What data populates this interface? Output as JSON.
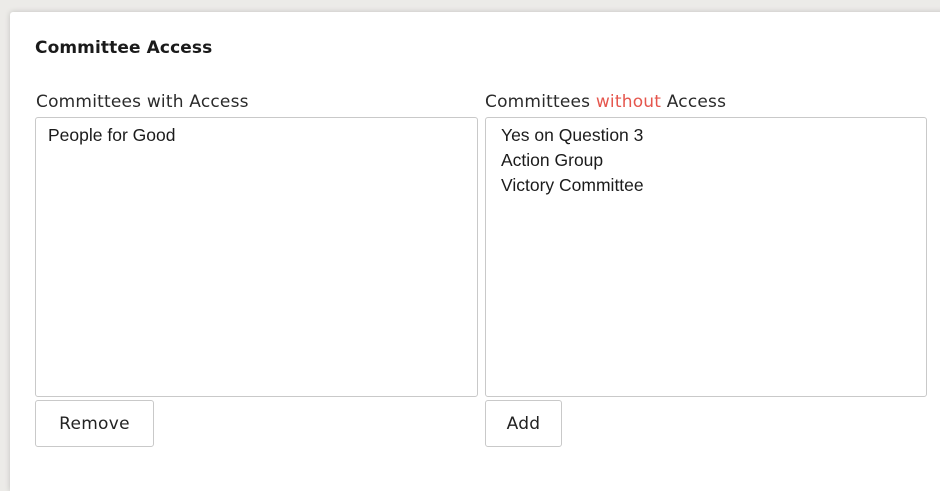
{
  "section": {
    "title": "Committee Access"
  },
  "with_access": {
    "label": "Committees with Access",
    "items": [
      "People for Good"
    ],
    "button_label": "Remove"
  },
  "without_access": {
    "label_prefix": "Committees ",
    "label_highlight": "without",
    "label_suffix": " Access",
    "highlight_color": "#e5564d",
    "items": [
      "Yes on Question 3",
      "Action Group",
      "Victory Committee"
    ],
    "button_label": "Add"
  }
}
